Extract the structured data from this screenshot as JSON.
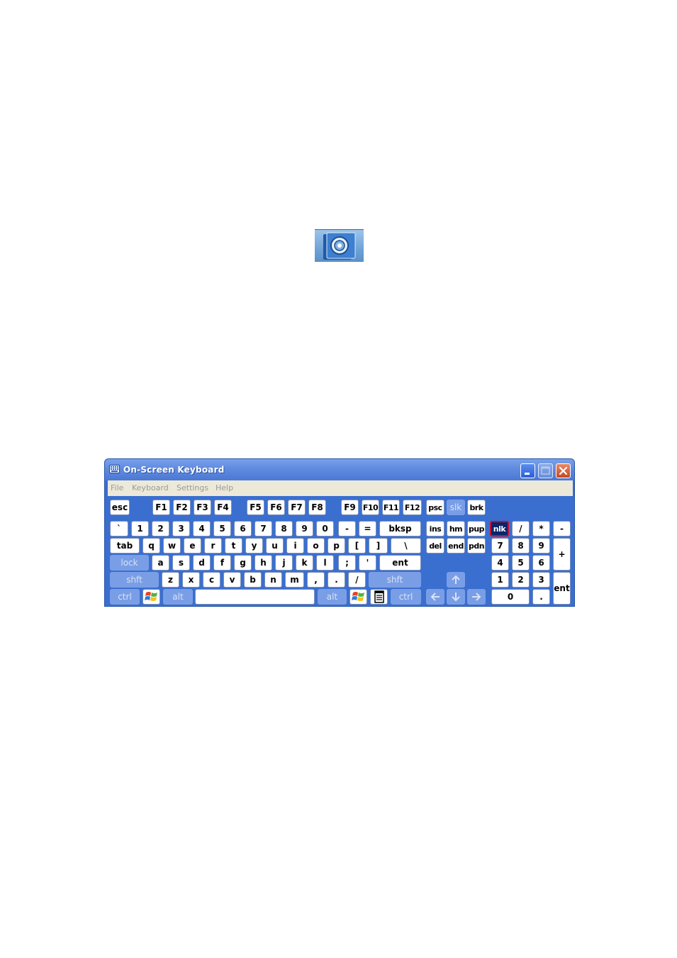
{
  "window": {
    "title": "On-Screen Keyboard",
    "menu": [
      "File",
      "Keyboard",
      "Settings",
      "Help"
    ]
  },
  "icons": {
    "app_icon": "on-screen-keyboard-shortcut-icon",
    "title_icon": "keyboard-icon",
    "minimize": "minimize-icon",
    "maximize": "maximize-icon",
    "close": "close-icon",
    "windows": "windows-logo-icon",
    "application": "application-menu-icon"
  },
  "keys": {
    "esc": "esc",
    "f1": "F1",
    "f2": "F2",
    "f3": "F3",
    "f4": "F4",
    "f5": "F5",
    "f6": "F6",
    "f7": "F7",
    "f8": "F8",
    "f9": "F9",
    "f10": "F10",
    "f11": "F11",
    "f12": "F12",
    "psc": "psc",
    "slk": "slk",
    "brk": "brk",
    "backtick": "`",
    "n1": "1",
    "n2": "2",
    "n3": "3",
    "n4": "4",
    "n5": "5",
    "n6": "6",
    "n7": "7",
    "n8": "8",
    "n9": "9",
    "n0": "0",
    "minus": "-",
    "equals": "=",
    "bksp": "bksp",
    "ins": "ins",
    "hm": "hm",
    "pup": "pup",
    "nlk": "nlk",
    "kp_div": "/",
    "kp_mul": "*",
    "kp_minus": "-",
    "tab": "tab",
    "q": "q",
    "w": "w",
    "e": "e",
    "r": "r",
    "t": "t",
    "y": "y",
    "u": "u",
    "i": "i",
    "o": "o",
    "p": "p",
    "lbracket": "[",
    "rbracket": "]",
    "backslash": "\\",
    "del": "del",
    "end": "end",
    "pdn": "pdn",
    "kp7": "7",
    "kp8": "8",
    "kp9": "9",
    "kp_plus": "+",
    "lock": "lock",
    "a": "a",
    "s": "s",
    "d": "d",
    "f": "f",
    "g": "g",
    "h": "h",
    "j": "j",
    "k": "k",
    "l": "l",
    "semicolon": ";",
    "quote": "'",
    "ent": "ent",
    "kp4": "4",
    "kp5": "5",
    "kp6": "6",
    "lshft": "shft",
    "z": "z",
    "x": "x",
    "c": "c",
    "v": "v",
    "b": "b",
    "n": "n",
    "m": "m",
    "comma": ",",
    "period": ".",
    "slash": "/",
    "rshft": "shft",
    "kp1": "1",
    "kp2": "2",
    "kp3": "3",
    "kp_ent": "ent",
    "lctrl": "ctrl",
    "lalt": "alt",
    "space": "",
    "ralt": "alt",
    "rctrl": "ctrl",
    "kp0": "0",
    "kp_dot": "."
  },
  "colors": {
    "window_bg": "#3a6fd0",
    "modifier_key": "#7a9ee6",
    "numlock_active": "#0a246a",
    "numlock_border": "#c8102e"
  }
}
